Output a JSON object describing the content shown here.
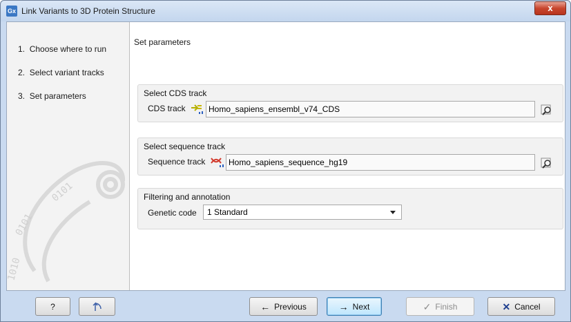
{
  "window": {
    "app_icon": "Gx",
    "title": "Link Variants to 3D Protein Structure",
    "close_label": "x"
  },
  "steps": [
    {
      "number": "1.",
      "label": "Choose where to run"
    },
    {
      "number": "2.",
      "label": "Select variant tracks"
    },
    {
      "number": "3.",
      "label": "Set parameters"
    }
  ],
  "panel": {
    "title": "Set parameters",
    "cds_group": {
      "heading": "Select CDS track",
      "field_label": "CDS track",
      "value": "Homo_sapiens_ensembl_v74_CDS",
      "icon": "cds-track-icon"
    },
    "sequence_group": {
      "heading": "Select sequence track",
      "field_label": "Sequence track",
      "value": "Homo_sapiens_sequence_hg19",
      "icon": "sequence-track-icon"
    },
    "filtering_group": {
      "heading": "Filtering and annotation",
      "field_label": "Genetic code",
      "selected": "1 Standard"
    }
  },
  "buttons": {
    "help": "?",
    "reset_icon": "reset-icon",
    "previous": "Previous",
    "next": "Next",
    "finish": "Finish",
    "cancel": "Cancel"
  },
  "colors": {
    "window_frame": "#c9daf0",
    "close_button": "#c8462e",
    "primary_button_border": "#3c7fb1",
    "cancel_x": "#1f3f8f"
  }
}
